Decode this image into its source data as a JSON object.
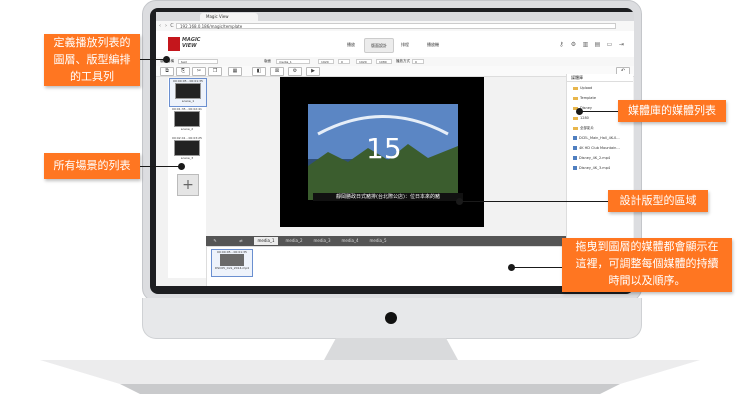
{
  "browser": {
    "tab_title": "Magic View",
    "address": "192.168.0.186/magic/template",
    "back": "‹",
    "forward": "›",
    "reload": "C"
  },
  "app": {
    "logo_line1": "MAGIC",
    "logo_line2": "VIEW",
    "nav_tabs": [
      "播放",
      "版面設計",
      "排程",
      "播放機"
    ],
    "header_icons": [
      "key-icon",
      "gear-icon",
      "trash-icon",
      "chart-icon",
      "monitor-icon",
      "logout-icon"
    ]
  },
  "toolbar": {
    "layout_label": "版面名稱",
    "layout_value": "test",
    "template_label": "版面",
    "template_value": "media_1",
    "field1": "1920",
    "field2": "0",
    "field3": "1920",
    "field4": "1080",
    "mode_label": "播放方式",
    "mode_value": "0",
    "icons": [
      "copy-icon",
      "paste-icon",
      "cut-icon",
      "duplicate-icon",
      "grid-icon",
      "layer-icon",
      "delete-icon",
      "settings-icon",
      "play-icon"
    ]
  },
  "scenes": [
    {
      "top_label": "00:00:05 - 00:01:35",
      "name": "scene_1"
    },
    {
      "top_label": "00:01:35 - 00:02:41",
      "name": "scene_2"
    },
    {
      "top_label": "00:02:41 - 00:03:25",
      "name": "scene_3"
    }
  ],
  "add_scene": "+",
  "preview": {
    "subtitle": "靜岡勝政日式豬排(台北際公店)：位日本來的豬"
  },
  "media_library": {
    "title": "媒體庫",
    "items": [
      {
        "type": "folder",
        "label": "Upload"
      },
      {
        "type": "folder",
        "label": "Template"
      },
      {
        "type": "folder",
        "label": "Disney"
      },
      {
        "type": "folder",
        "label": "1280"
      },
      {
        "type": "folder",
        "label": "全部影片"
      },
      {
        "type": "file",
        "label": "DCEL_Main_Hall_4K-0..."
      },
      {
        "type": "file",
        "label": "4K HD Club Mountain..."
      },
      {
        "type": "file",
        "label": "Disney_4K_2.mp4"
      },
      {
        "type": "file",
        "label": "Disney_4K_3.mp4"
      }
    ]
  },
  "timeline": {
    "tabs": [
      "media_1",
      "media_2",
      "media_3",
      "media_4",
      "media_5"
    ],
    "clip_time": "00:00:05 - 00:01:35",
    "clip_name": "DSC05_CLS_2014.mp4"
  },
  "callouts": {
    "toolbar": "定義播放列表的\n圖層、版型編排\n的工具列",
    "scenes": "所有場景的列表",
    "media_library": "媒體庫的媒體列表",
    "layout_area": "設計版型的區域",
    "timeline": "拖曳到圖層的媒體都會顯示在\n這裡，可調整每個媒體的持續\n時間以及順序。"
  },
  "colors": {
    "callout": "#ff7621",
    "brand_red": "#c4161c",
    "screen_bg": "#f2f2f2"
  }
}
